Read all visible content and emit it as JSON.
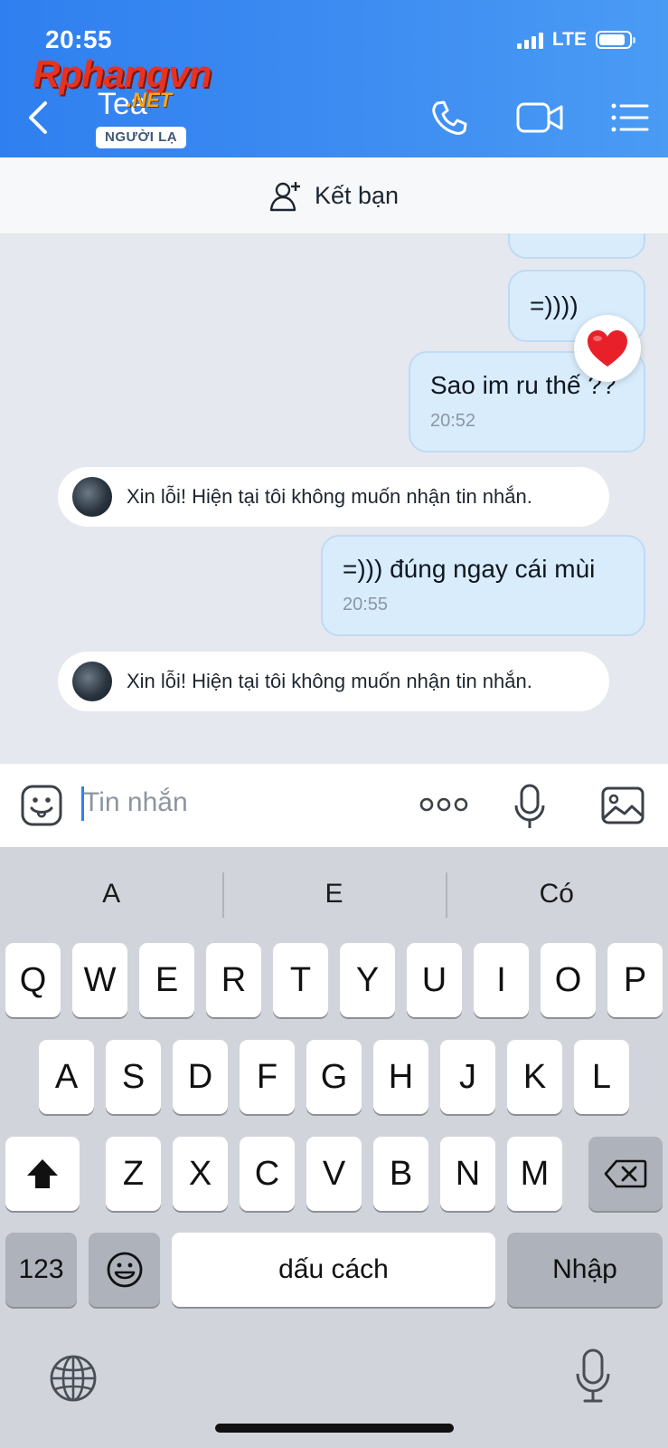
{
  "status_bar": {
    "time": "20:55",
    "network": "LTE"
  },
  "watermark": {
    "brand": "Rphangvn",
    "suffix": ".NET"
  },
  "header": {
    "contact_name": "Tea",
    "badge": "NGƯỜI LẠ"
  },
  "add_friend": {
    "label": "Kết bạn"
  },
  "messages": [
    {
      "text": "=))))"
    },
    {
      "text": "Sao im ru thế ??",
      "time": "20:52"
    },
    {
      "text": "Xin lỗi! Hiện tại tôi không muốn nhận tin nhắn."
    },
    {
      "text": "=))) đúng ngay cái mùi",
      "time": "20:55"
    },
    {
      "text": "Xin lỗi! Hiện tại tôi không muốn nhận tin nhắn."
    }
  ],
  "composer": {
    "placeholder": "Tin nhắn"
  },
  "keyboard": {
    "suggestions": [
      "A",
      "E",
      "Có"
    ],
    "row1": [
      "Q",
      "W",
      "E",
      "R",
      "T",
      "Y",
      "U",
      "I",
      "O",
      "P"
    ],
    "row2": [
      "A",
      "S",
      "D",
      "F",
      "G",
      "H",
      "J",
      "K",
      "L"
    ],
    "row3": [
      "Z",
      "X",
      "C",
      "V",
      "B",
      "N",
      "M"
    ],
    "numbers_key": "123",
    "space_key": "dấu cách",
    "return_key": "Nhập"
  },
  "colors": {
    "header": "#2f7ff0",
    "outgoing_bubble": "#d8ecfc",
    "heart": "#e8202a"
  }
}
